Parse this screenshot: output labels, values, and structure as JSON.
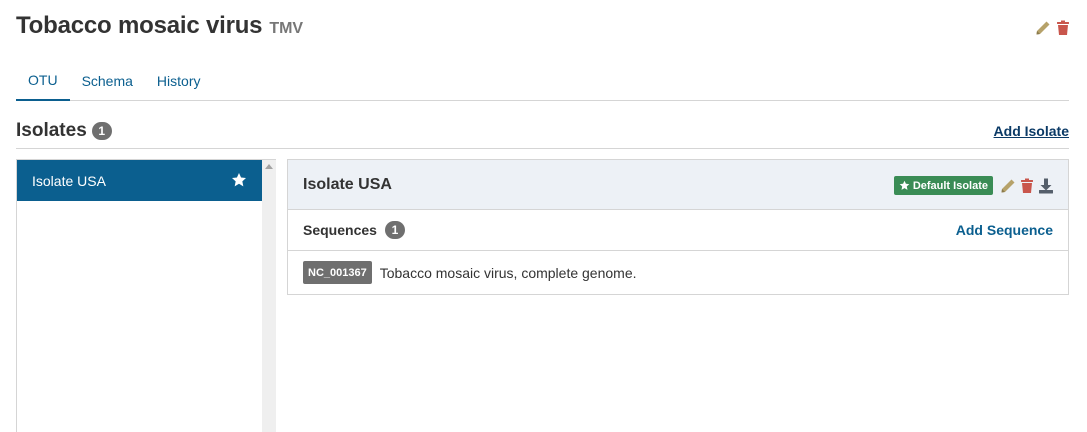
{
  "otu": {
    "name": "Tobacco mosaic virus",
    "abbreviation": "TMV"
  },
  "tabs": [
    {
      "label": "OTU",
      "active": true
    },
    {
      "label": "Schema",
      "active": false
    },
    {
      "label": "History",
      "active": false
    }
  ],
  "isolates": {
    "title": "Isolates",
    "count": "1",
    "add_label": "Add Isolate",
    "items": [
      {
        "label": "Isolate USA",
        "default": true,
        "selected": true
      }
    ]
  },
  "detail": {
    "title": "Isolate USA",
    "default_label": "Default Isolate",
    "sequences_title": "Sequences",
    "sequences_count": "1",
    "add_sequence_label": "Add Sequence",
    "sequences": [
      {
        "accession": "NC_001367",
        "definition": "Tobacco mosaic virus, complete genome."
      }
    ]
  },
  "icons": {
    "edit": "pencil-icon",
    "delete": "trash-icon",
    "download": "download-icon",
    "default": "star-icon"
  },
  "colors": {
    "primary": "#0b5f8f",
    "success": "#3a8c55",
    "edit_icon": "#b6a26a",
    "delete_icon": "#c9564c",
    "badge": "#6f6f6f"
  }
}
